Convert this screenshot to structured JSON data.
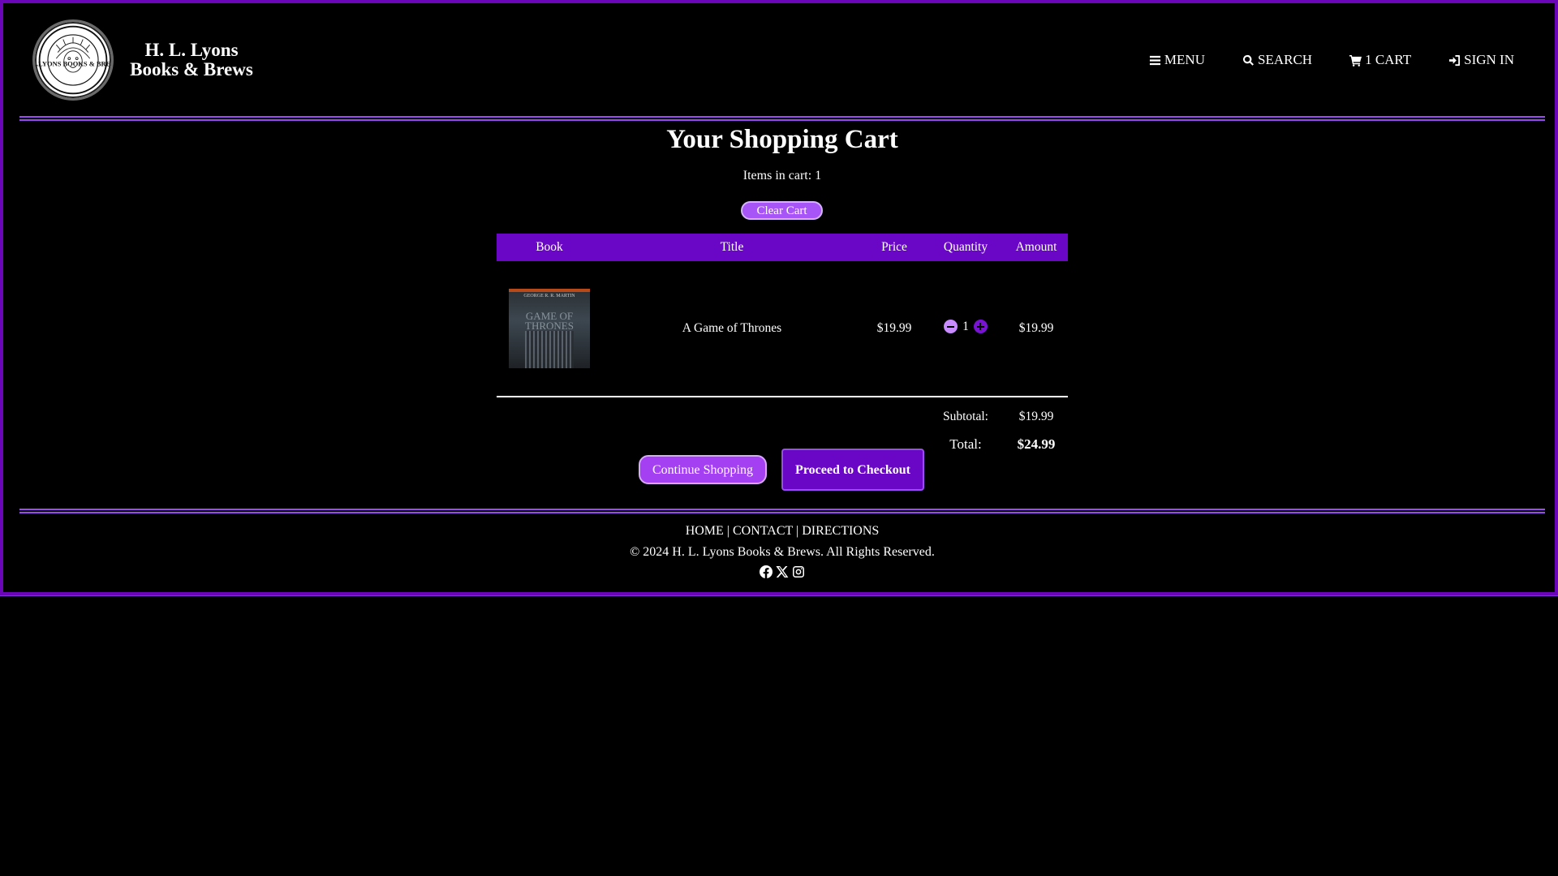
{
  "brand": {
    "line1": "H. L. Lyons",
    "line2": "Books & Brews",
    "logo_icon": "lion-seal-logo",
    "logo_text": "H.L.LYONS BOOKS & BREWS"
  },
  "nav": {
    "menu": "MENU",
    "search": "SEARCH",
    "cart": "1 CART",
    "sign_in": "SIGN IN"
  },
  "cart": {
    "title": "Your Shopping Cart",
    "items_in_cart": "Items in cart: 1",
    "clear_label": "Clear Cart",
    "columns": [
      "Book",
      "Title",
      "Price",
      "Quantity",
      "Amount"
    ],
    "items": [
      {
        "cover_author": "GEORGE R. R. MARTIN",
        "cover_title": "GAME OF THRONES",
        "title": "A Game of Thrones",
        "price": "$19.99",
        "quantity": "1",
        "amount": "$19.99"
      }
    ],
    "subtotal_label": "Subtotal:",
    "subtotal": "$19.99",
    "total_label": "Total:",
    "total": "$24.99",
    "continue_label": "Continue Shopping",
    "checkout_label": "Proceed to Checkout"
  },
  "footer": {
    "home": "HOME",
    "contact": "CONTACT",
    "directions": "DIRECTIONS",
    "sep": "|",
    "copyright": "© 2024 H. L. Lyons Books & Brews. All Rights Reserved.",
    "social_icons": [
      "facebook-icon",
      "x-icon",
      "instagram-icon"
    ]
  },
  "colors": {
    "accent": "#6a06c6",
    "accent_light": "#a855f7",
    "background": "#000000",
    "text": "#ffffff"
  }
}
